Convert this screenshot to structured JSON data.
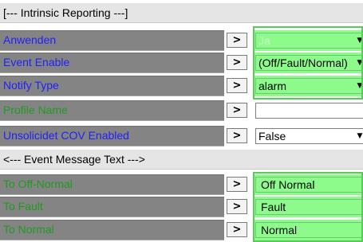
{
  "sections": {
    "intrinsic": "[--- Intrinsic Reporting ---]",
    "event_message": "<--- Event Message Text --->"
  },
  "arrow_glyph": ">",
  "rows": {
    "anwenden": {
      "label": "Anwenden",
      "value": "Ja"
    },
    "event_enable": {
      "label": "Event Enable",
      "value": "(Off/Fault/Normal)"
    },
    "notify_type": {
      "label": "Notify Type",
      "value": "alarm"
    },
    "profile_name": {
      "label": "Profile Name",
      "value": ""
    },
    "unsolicited_cov": {
      "label": "Unsolicidet COV Enabled",
      "value": "False"
    },
    "to_off_normal": {
      "label": "To Off-Normal",
      "value": "Off Normal"
    },
    "to_fault": {
      "label": "To Fault",
      "value": "Fault"
    },
    "to_normal": {
      "label": "To Normal",
      "value": "Normal"
    }
  },
  "colors": {
    "label_blue": "#1f1fff",
    "label_green": "#1f9b1f",
    "highlight_green": "#8cfb8c",
    "label_bg": "#848484",
    "section_bg": "#e5e5e5"
  },
  "icons": {
    "dropdown": "caret-down-icon",
    "arrow": "chevron-right-icon"
  }
}
